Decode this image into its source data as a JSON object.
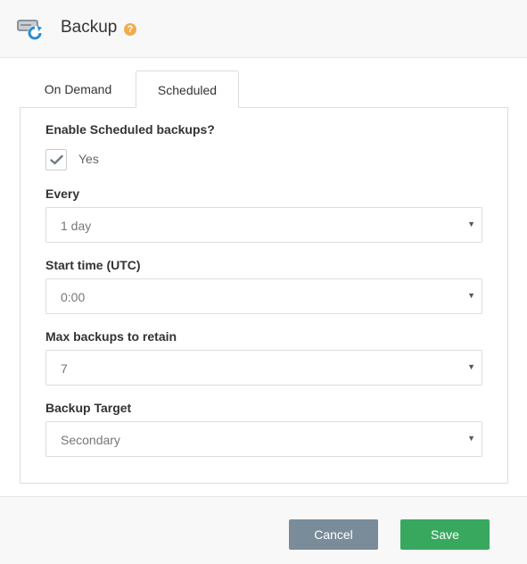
{
  "header": {
    "title": "Backup",
    "help_icon": "question-circle-icon",
    "app_icon": "backup-drive-icon",
    "help_glyph": "?"
  },
  "tabs": [
    {
      "label": "On Demand",
      "active": false
    },
    {
      "label": "Scheduled",
      "active": true
    }
  ],
  "form": {
    "enable": {
      "label": "Enable Scheduled backups?",
      "checkbox_label": "Yes",
      "checked": true
    },
    "every": {
      "label": "Every",
      "value": "1 day"
    },
    "start_time": {
      "label": "Start time (UTC)",
      "value": "0:00"
    },
    "max_backups": {
      "label": "Max backups to retain",
      "value": "7"
    },
    "target": {
      "label": "Backup Target",
      "value": "Secondary"
    }
  },
  "footer": {
    "cancel_label": "Cancel",
    "save_label": "Save"
  },
  "colors": {
    "help": "#f0ad4e",
    "cancel": "#7a8c9a",
    "save": "#39a85f",
    "icon_blue": "#2e8ccf"
  }
}
